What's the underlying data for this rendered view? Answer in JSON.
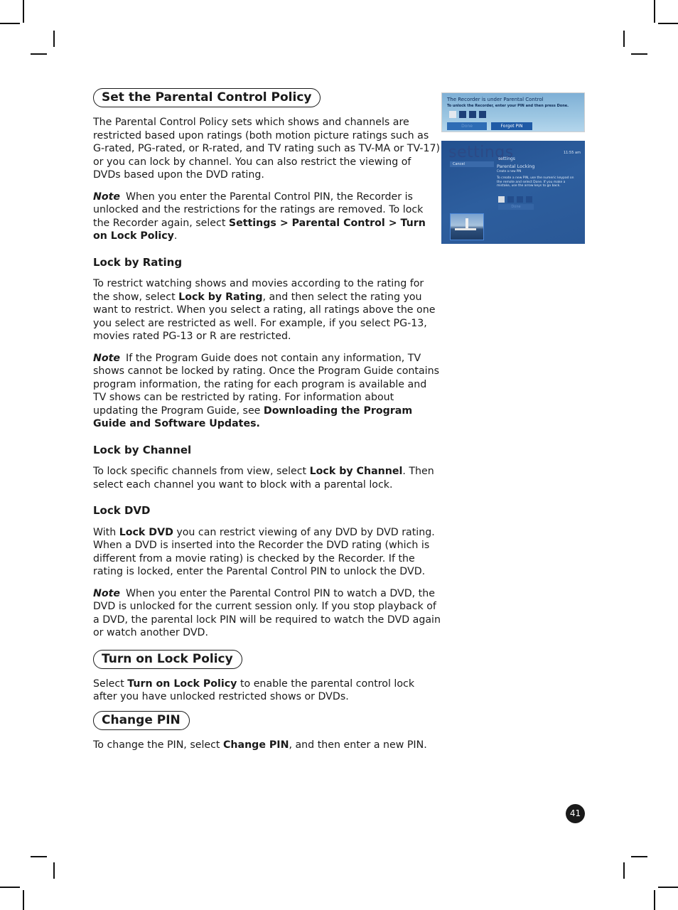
{
  "sections": {
    "parental_policy": {
      "title": "Set the Parental Control Policy",
      "intro": "The Parental Control Policy sets which shows and channels are restricted based upon ratings (both motion picture ratings such as G-rated, PG-rated, or R-rated, and TV rating such as TV-MA or TV-17) or you can lock by channel. You can also restrict the viewing of DVDs based upon the DVD rating.",
      "note1": {
        "label": "Note",
        "text_before": "When you enter the Parental Control PIN, the Recorder is unlocked and the restrictions for the ratings are removed. To lock the Recorder again, select ",
        "bold": "Settings > Parental Control > Turn on Lock Policy",
        "text_after": "."
      },
      "lock_by_rating": {
        "heading": "Lock by Rating",
        "text_before": "To restrict watching shows and movies according to the rating for the show, select ",
        "bold": "Lock by Rating",
        "text_after": ", and then select the rating you want to restrict. When you select a rating, all ratings above the one you select are restricted as well. For example, if you select PG-13, movies rated PG-13 or R are restricted."
      },
      "note2": {
        "label": "Note",
        "text_before": "If the Program Guide does not contain any information, TV shows cannot be locked by rating. Once the Program Guide contains program information, the rating for each program is available and TV shows can be restricted by rating. For information about updating the Program Guide, see ",
        "bold": "Downloading the Program Guide and Software Updates."
      },
      "lock_by_channel": {
        "heading": "Lock by Channel",
        "text_before": "To lock specific channels from view, select ",
        "bold": "Lock by Channel",
        "text_after": ". Then select each channel you want to block with a parental lock."
      },
      "lock_dvd": {
        "heading": "Lock DVD",
        "text_before": "With ",
        "bold": "Lock DVD",
        "text_after": " you can restrict viewing of any DVD by DVD rating. When a DVD is inserted into the Recorder the DVD rating (which is different from a movie rating) is checked by the Recorder. If the rating is locked, enter the Parental Control PIN to unlock the DVD."
      },
      "note3": {
        "label": "Note",
        "text": "When you enter the Parental Control PIN to watch a DVD, the DVD is unlocked for the current session only. If you stop playback of a DVD, the parental lock PIN will be required to watch the DVD again or watch another DVD."
      }
    },
    "turn_on_lock": {
      "title": "Turn on Lock Policy",
      "text_before": "Select ",
      "bold": "Turn on Lock Policy",
      "text_after": " to enable the parental control lock after you have unlocked restricted shows or DVDs."
    },
    "change_pin": {
      "title": "Change PIN",
      "text_before": "To change the PIN, select ",
      "bold": "Change PIN",
      "text_after": ", and then enter a new PIN."
    }
  },
  "screenshot_unlock": {
    "title": "The Recorder is under Parental Control",
    "subtitle": "To unlock the Recorder, enter your PIN and then press Done.",
    "done_label": "Done",
    "forgot_label": "Forgot PIN"
  },
  "screenshot_settings": {
    "big_title": "settings",
    "breadcrumb": "settings",
    "time": "11:55 am",
    "cancel_label": "Cancel",
    "heading": "Parental Locking",
    "subheading": "Create a new PIN",
    "instructions": "To create a new PIN, use the numeric keypad on the remote and select Done. If you make a mistake, use the arrow keys to go back.",
    "done_label": "Done"
  },
  "page_number": "41"
}
